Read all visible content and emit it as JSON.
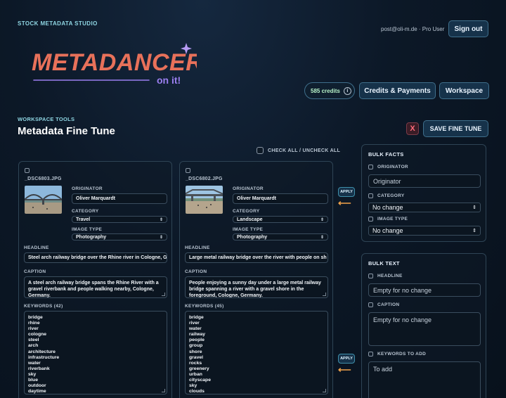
{
  "header": {
    "brand": "STOCK METADATA STUDIO",
    "user_email": "post@oli-m.de · Pro User",
    "sign_out": "Sign out",
    "logo_text": "METADANCER",
    "logo_tagline": "on it!",
    "credits_label": "585 credits",
    "credits_button": "Credits & Payments",
    "workspace_button": "Workspace"
  },
  "page": {
    "section_label": "WORKSPACE TOOLS",
    "title": "Metadata Fine Tune",
    "close_label": "X",
    "save_button": "SAVE FINE TUNE",
    "check_all": "CHECK ALL / UNCHECK ALL"
  },
  "labels": {
    "originator": "ORIGINATOR",
    "category": "CATEGORY",
    "image_type": "IMAGE TYPE",
    "headline": "HEADLINE",
    "caption": "CAPTION",
    "apply": "APPLY"
  },
  "images": [
    {
      "filename": "_DSC6803.JPG",
      "originator": "Oliver Marquardt",
      "category": "Travel",
      "image_type": "Photography",
      "headline": "Steel arch railway bridge over the Rhine river in Cologne, G",
      "caption": "A steel arch railway bridge spans the Rhine River with a gravel riverbank and people walking nearby, Cologne, Germany.",
      "keywords_label": "KEYWORDS (42)",
      "keywords": "bridge\nrhine\nriver\ncologne\nsteel\narch\narchitecture\ninfrastructure\nwater\nriverbank\nsky\nblue\noutdoor\ndaytime\npeople\ngraffiti"
    },
    {
      "filename": "_DSC6802.JPG",
      "originator": "Oliver Marquardt",
      "category": "Landscape",
      "image_type": "Photography",
      "headline": "Large metal railway bridge over the river with people on sh",
      "caption": "People enjoying a sunny day under a large metal railway bridge spanning a river with a gravel shore in the foreground, Cologne, Germany.",
      "keywords_label": "KEYWORDS (45)",
      "keywords": "bridge\nriver\nwater\nrailway\npeople\ngroup\nshore\ngravel\nrocks\ngreenery\nurban\ncityscape\nsky\nclouds\ndaytime\nsunny"
    }
  ],
  "bulk_facts": {
    "title": "BULK FACTS",
    "originator_label": "ORIGINATOR",
    "originator_placeholder": "Originator",
    "category_label": "CATEGORY",
    "category_value": "No change",
    "image_type_label": "IMAGE TYPE",
    "image_type_value": "No change"
  },
  "bulk_text": {
    "title": "BULK TEXT",
    "headline_label": "HEADLINE",
    "headline_placeholder": "Empty for no change",
    "caption_label": "CAPTION",
    "caption_placeholder": "Empty for no change",
    "keywords_label": "KEYWORDS TO ADD",
    "keywords_placeholder": "To add"
  },
  "colors": {
    "accent": "#8fd6e3",
    "logo": "#e8715a",
    "logo_accent": "#9b7ff0",
    "arrow": "#f0a24a",
    "close": "#ff6b7a"
  }
}
